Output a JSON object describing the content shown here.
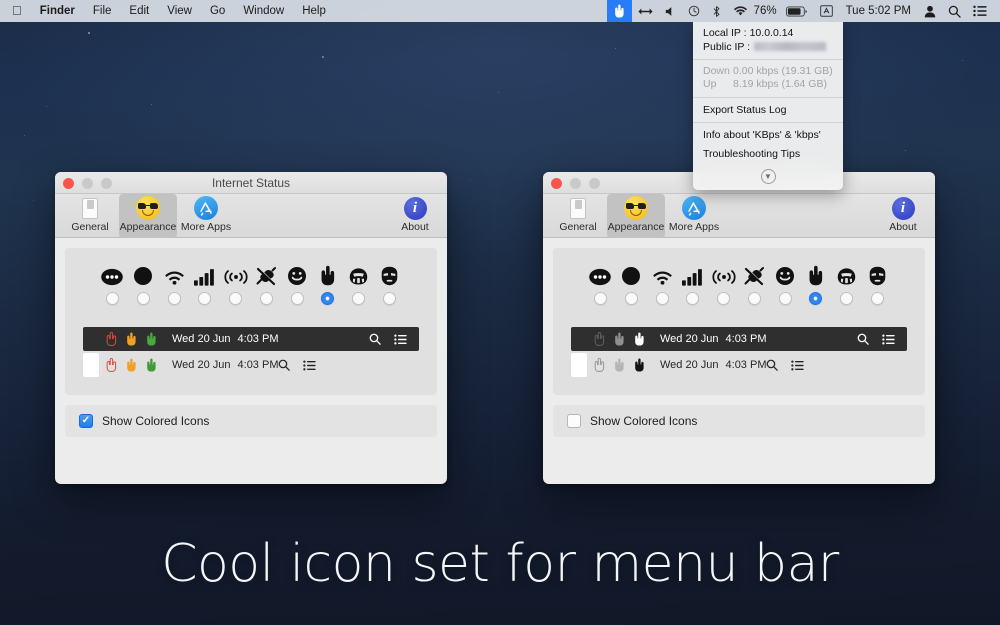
{
  "menubar": {
    "apple_icon": "apple-logo",
    "items": [
      {
        "label": "Finder",
        "bold": true
      },
      {
        "label": "File",
        "bold": false
      },
      {
        "label": "Edit",
        "bold": false
      },
      {
        "label": "View",
        "bold": false
      },
      {
        "label": "Go",
        "bold": false
      },
      {
        "label": "Window",
        "bold": false
      },
      {
        "label": "Help",
        "bold": false
      }
    ],
    "status_icons": [
      {
        "name": "rock-hand-icon",
        "active": true
      },
      {
        "name": "arrows-horizontal-icon",
        "active": false
      },
      {
        "name": "volume-icon",
        "active": false
      },
      {
        "name": "time-machine-icon",
        "active": false
      },
      {
        "name": "bluetooth-icon",
        "active": false
      },
      {
        "name": "wifi-icon",
        "active": false
      }
    ],
    "battery_percent": "76%",
    "battery_icon": "battery-icon",
    "keyboard_icon": "keyboard-input-icon",
    "clock": "Tue 5:02 PM",
    "user_icon": "user-icon",
    "search_icon": "search-icon",
    "control_center_icon": "list-icon"
  },
  "dropdown": {
    "local_ip_label": "Local IP  :",
    "local_ip_value": "10.0.0.14",
    "public_ip_label": "Public IP :",
    "public_ip_value": "",
    "down_label": "Down",
    "down_value": "0.00 kbps (19.31 GB)",
    "up_label": "Up",
    "up_value": "8.19 kbps (1.64 GB)",
    "export_label": "Export Status Log",
    "info_label": "Info about 'KBps' & 'kbps'",
    "troubleshoot_label": "Troubleshooting Tips",
    "expand_icon": "chevron-down-icon"
  },
  "window": {
    "title": "Internet Status",
    "traffic_lights": [
      "close-button",
      "minimize-button",
      "maximize-button"
    ],
    "tabs": [
      {
        "label": "General",
        "icon": "switch-icon",
        "selected": false
      },
      {
        "label": "Appearance",
        "icon": "sunglasses-face-icon",
        "selected": true
      },
      {
        "label": "More Apps",
        "icon": "app-store-icon",
        "selected": false
      }
    ],
    "about_label": "About",
    "about_icon": "info-icon",
    "icon_choices": [
      {
        "name": "dots-circle-icon",
        "selected": false
      },
      {
        "name": "filled-circle-icon",
        "selected": false
      },
      {
        "name": "wifi-icon",
        "selected": false
      },
      {
        "name": "signal-bars-icon",
        "selected": false
      },
      {
        "name": "broadcast-icon",
        "selected": false
      },
      {
        "name": "plug-icon",
        "selected": false
      },
      {
        "name": "smiley-face-icon",
        "selected": false
      },
      {
        "name": "rock-hand-icon",
        "selected": true
      },
      {
        "name": "stormtrooper-helmet-icon",
        "selected": false
      },
      {
        "name": "iron-man-mask-icon",
        "selected": false
      }
    ],
    "preview": {
      "date": "Wed 20 Jun",
      "time": "4:03 PM",
      "search_icon": "search-icon",
      "list_icon": "list-icon"
    },
    "checkbox_label": "Show Colored Icons"
  },
  "left_window": {
    "colored_icons_checked": true,
    "preview_colors_dark": [
      "#d8453c",
      "#f0a024",
      "#4aa83e"
    ],
    "preview_colors_light": [
      "#e05046",
      "#f0a024",
      "#3f9b35"
    ]
  },
  "right_window": {
    "colored_icons_checked": false,
    "preview_colors_dark": [
      "#5e5e5e",
      "#8f8f8f",
      "#ffffff"
    ],
    "preview_colors_light": [
      "#9a9a9a",
      "#b4b4b4",
      "#141414"
    ]
  },
  "caption": "Cool icon set for menu bar",
  "colors": {
    "accent_blue": "#2f86f5",
    "menubar_bg": "#e4e8ee",
    "window_bg": "#ececec",
    "desktop_top": "#1d3050",
    "desktop_bottom": "#101726"
  }
}
